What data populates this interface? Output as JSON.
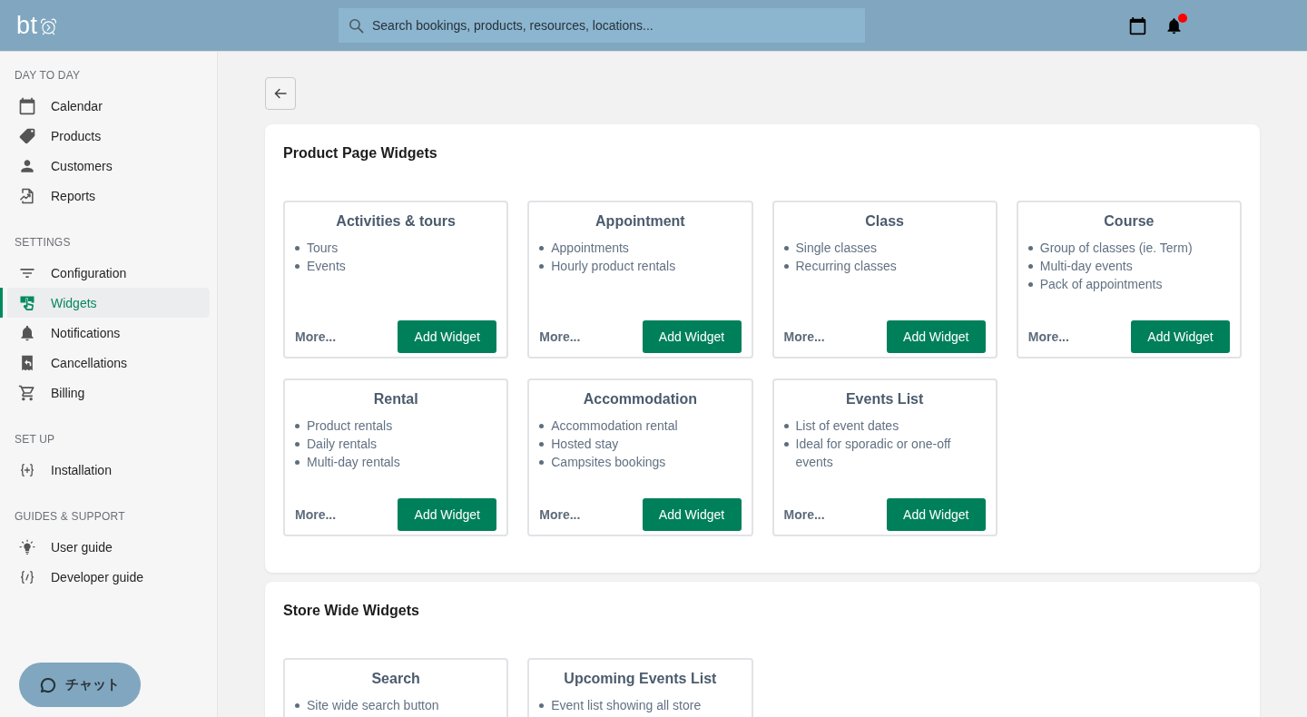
{
  "header": {
    "logo": "bt",
    "search": {
      "placeholder": "Search bookings, products, resources, locations..."
    },
    "notifications": {
      "unread": true
    }
  },
  "sidebar": {
    "groups": [
      {
        "heading": "DAY TO DAY",
        "items": [
          {
            "label": "Calendar",
            "selected": false
          },
          {
            "label": "Products",
            "selected": false
          },
          {
            "label": "Customers",
            "selected": false
          },
          {
            "label": "Reports",
            "selected": false
          }
        ]
      },
      {
        "heading": "SETTINGS",
        "items": [
          {
            "label": "Configuration",
            "selected": false
          },
          {
            "label": "Widgets",
            "selected": true
          },
          {
            "label": "Notifications",
            "selected": false
          },
          {
            "label": "Cancellations",
            "selected": false
          },
          {
            "label": "Billing",
            "selected": false
          }
        ]
      },
      {
        "heading": "SET UP",
        "items": [
          {
            "label": "Installation",
            "selected": false
          }
        ]
      },
      {
        "heading": "GUIDES & SUPPORT",
        "items": [
          {
            "label": "User guide",
            "selected": false
          },
          {
            "label": "Developer guide",
            "selected": false
          }
        ]
      }
    ]
  },
  "chat_button": {
    "label": "チャット"
  },
  "sections": [
    {
      "title": "Product Page Widgets",
      "widgets": [
        {
          "title": "Activities & tours",
          "features": [
            "Tours",
            "Events"
          ],
          "more_link": "More...",
          "button": "Add Widget"
        },
        {
          "title": "Appointment",
          "features": [
            "Appointments",
            "Hourly product rentals"
          ],
          "more_link": "More...",
          "button": "Add Widget"
        },
        {
          "title": "Class",
          "features": [
            "Single classes",
            "Recurring classes"
          ],
          "more_link": "More...",
          "button": "Add Widget"
        },
        {
          "title": "Course",
          "features": [
            "Group of classes (ie. Term)",
            "Multi-day events",
            "Pack of appointments"
          ],
          "more_link": "More...",
          "button": "Add Widget"
        },
        {
          "title": "Rental",
          "features": [
            "Product rentals",
            "Daily rentals",
            "Multi-day rentals"
          ],
          "more_link": "More...",
          "button": "Add Widget"
        },
        {
          "title": "Accommodation",
          "features": [
            "Accommodation rental",
            "Hosted stay",
            "Campsites bookings"
          ],
          "more_link": "More...",
          "button": "Add Widget"
        },
        {
          "title": "Events List",
          "features": [
            "List of event dates",
            "Ideal for sporadic or one-off events"
          ],
          "more_link": "More...",
          "button": "Add Widget"
        }
      ]
    },
    {
      "title": "Store Wide Widgets",
      "widgets": [
        {
          "title": "Search",
          "features": [
            "Site wide search button"
          ]
        },
        {
          "title": "Upcoming Events List",
          "features": [
            "Event list showing all store"
          ]
        }
      ]
    }
  ]
}
